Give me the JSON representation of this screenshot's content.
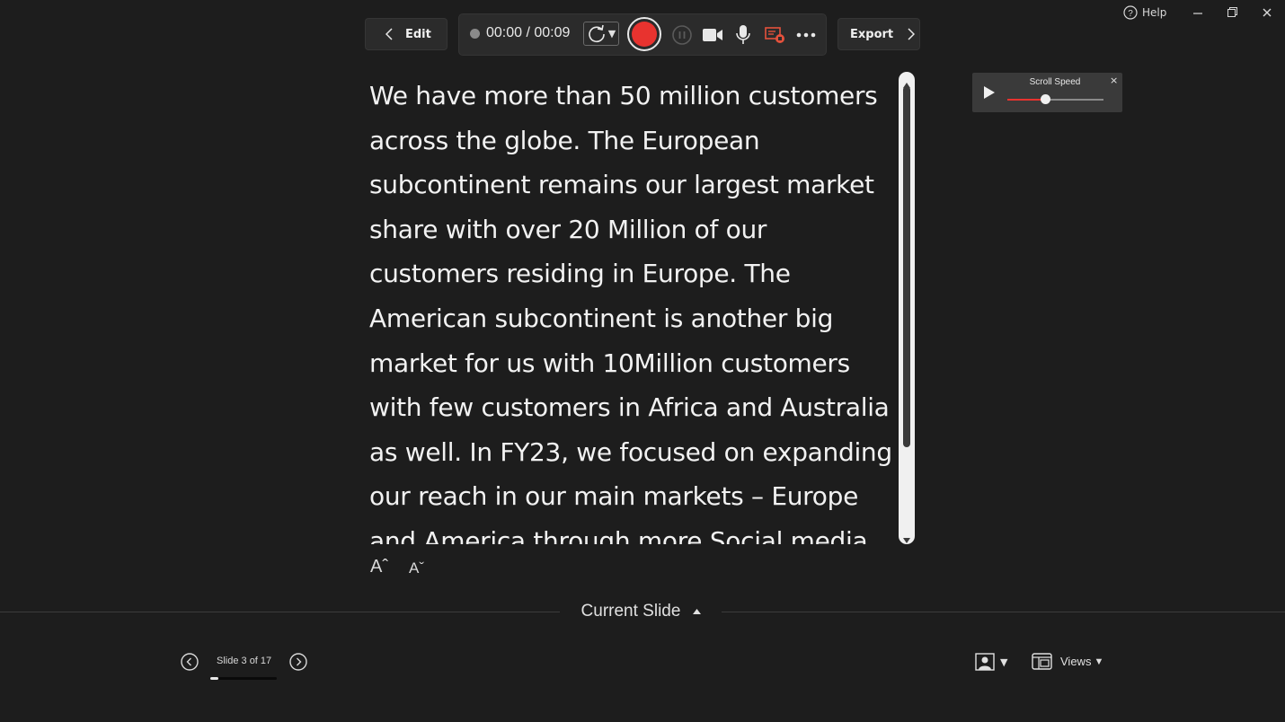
{
  "window": {
    "help_label": "Help",
    "icons": [
      "help-icon",
      "minimize-icon",
      "restore-icon",
      "close-icon"
    ]
  },
  "toolbar": {
    "edit_label": "Edit",
    "timer": "00:00 / 00:09",
    "export_label": "Export",
    "record_color": "#e8332f",
    "icons": [
      "chevron-left-icon",
      "retake-icon",
      "record-icon",
      "pause-icon",
      "camera-icon",
      "microphone-icon",
      "screen-record-icon",
      "more-icon",
      "chevron-right-icon"
    ]
  },
  "script": {
    "text": "We have more than 50 million customers across the globe. The European subcontinent remains our largest market share with over 20 Million of our customers residing in Europe. The American subcontinent is another big market for us with 10Million customers with few customers in Africa and Australia as well. In FY23, we focused on expanding our reach in our main markets – Europe and America through more Social media marketing"
  },
  "font_controls": {
    "increase_label": "Aˆ",
    "decrease_label": "Aˇ"
  },
  "scroll_speed": {
    "label": "Scroll Speed",
    "close_label": "×",
    "value_fraction": 0.4
  },
  "current_slide": {
    "label": "Current Slide"
  },
  "slide_nav": {
    "counter": "Slide 3 of 17",
    "current": 3,
    "total": 17
  },
  "bottom_right": {
    "views_label": "Views"
  }
}
